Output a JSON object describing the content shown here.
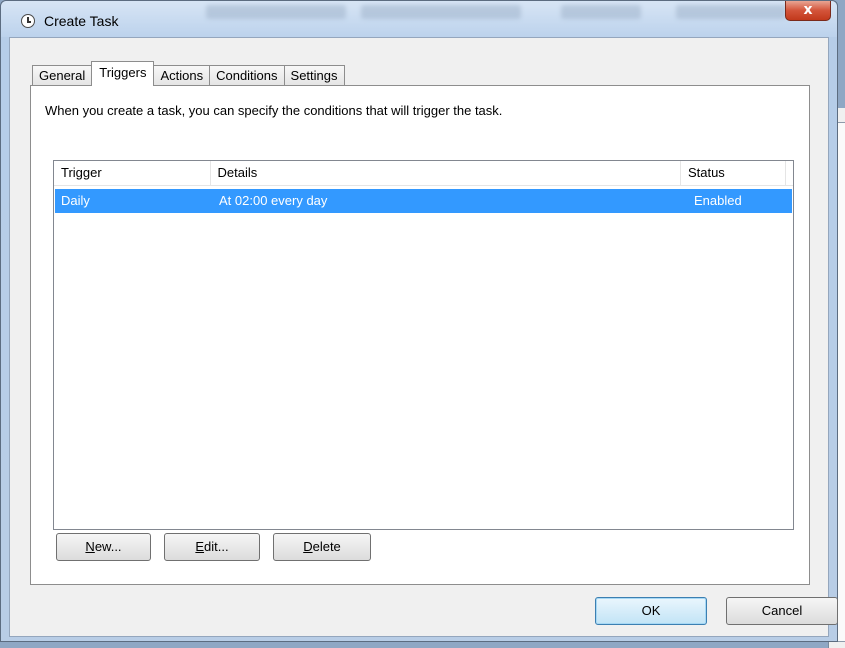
{
  "window": {
    "title": "Create Task",
    "close_glyph": "x"
  },
  "tabs": [
    {
      "label": "General",
      "active": false
    },
    {
      "label": "Triggers",
      "active": true
    },
    {
      "label": "Actions",
      "active": false
    },
    {
      "label": "Conditions",
      "active": false
    },
    {
      "label": "Settings",
      "active": false
    }
  ],
  "triggers_panel": {
    "intro": "When you create a task, you can specify the conditions that will trigger the task.",
    "columns": [
      "Trigger",
      "Details",
      "Status"
    ],
    "rows": [
      {
        "trigger": "Daily",
        "details": "At 02:00 every day",
        "status": "Enabled",
        "selected": true
      }
    ],
    "buttons": {
      "new_accel": "N",
      "new_rest": "ew...",
      "edit_accel": "E",
      "edit_rest": "dit...",
      "delete_accel": "D",
      "delete_rest": "elete"
    }
  },
  "footer": {
    "ok_label": "OK",
    "cancel_label": "Cancel"
  },
  "colors": {
    "selection": "#3399ff",
    "close_button": "#c2391c"
  }
}
